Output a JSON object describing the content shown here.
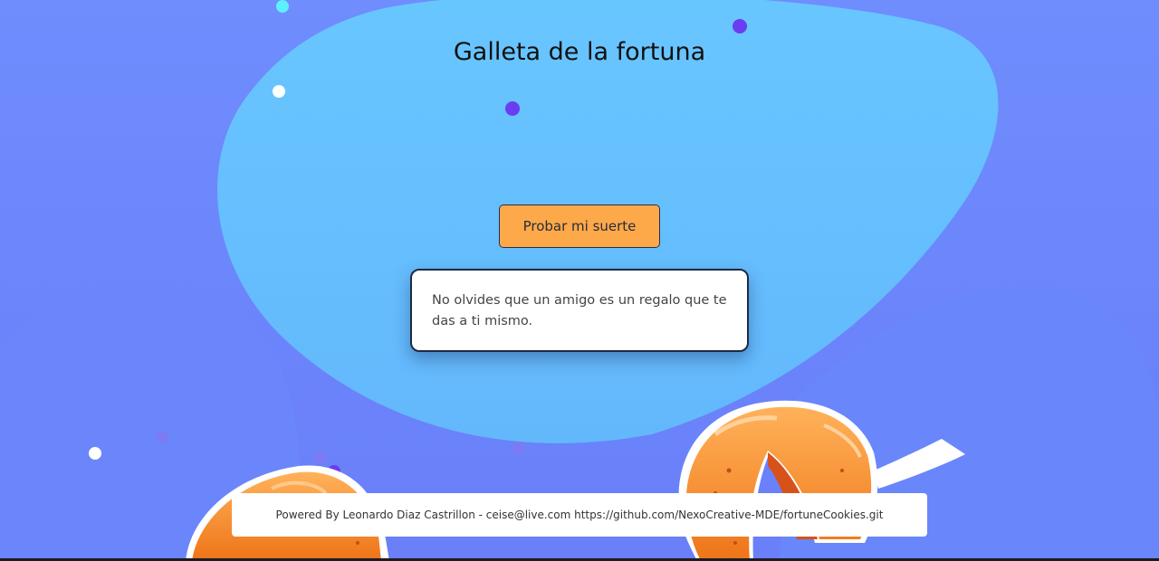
{
  "page": {
    "title": "Galleta de la fortuna"
  },
  "action": {
    "button_label": "Probar mi suerte"
  },
  "fortune": {
    "message": "No olvides que un amigo es un regalo que te das a ti mismo."
  },
  "footer": {
    "credit": "Powered By Leonardo Diaz Castrillon - ceise@live.com ",
    "repo_link": "https://github.com/NexoCreative-MDE/fortuneCookies.git"
  },
  "decor": {
    "cookie_left": "fortune-cookie-illustration",
    "cookie_right": "fortune-cookie-illustration"
  },
  "colors": {
    "background": "#6f8dfd",
    "blob": "#66c3ff",
    "button": "#fda94a",
    "dot_purple": "#6a3df2",
    "cookie_orange": "#f7862a"
  }
}
